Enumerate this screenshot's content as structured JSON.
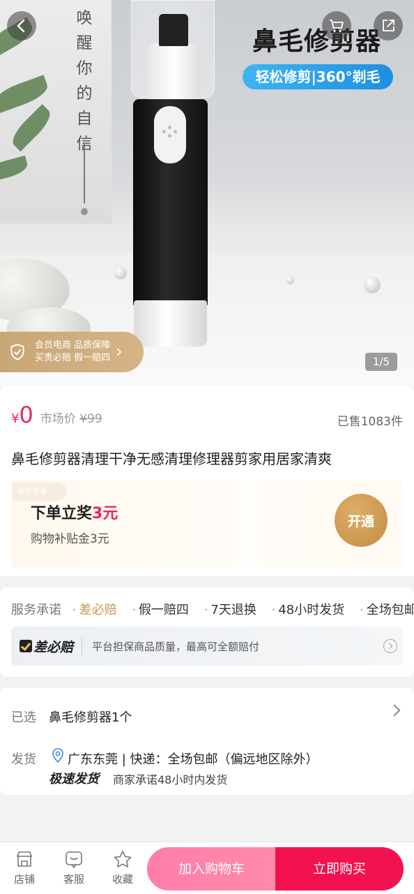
{
  "hero": {
    "vertical_text": "唤醒你的自信",
    "title": "鼻毛修剪器",
    "subtitle": "轻松修剪|360°剃毛",
    "guarantee_line1": "会员电商 品质保障",
    "guarantee_line2": "买贵必赔 假一赔四",
    "page_indicator": "1/5"
  },
  "price": {
    "currency": "¥",
    "value": "0",
    "market_label": "市场价",
    "market_price": "¥99",
    "sold": "已售1083件"
  },
  "product_title": "鼻毛修剪器清理干净无感清理修理器剪家用居家清爽",
  "promo": {
    "tag": "会员专享",
    "main_prefix": "下单立奖",
    "main_amount": "3元",
    "sub": "购物补贴金3元",
    "open_label": "开通"
  },
  "service": {
    "label": "服务承诺",
    "items": [
      "差必赔",
      "假一赔四",
      "7天退换",
      "48小时发货",
      "全场包邮"
    ],
    "badge": "差必赔",
    "desc": "平台担保商品质量，最高可全额赔付"
  },
  "spec": {
    "selected_label": "已选",
    "selected_value": "鼻毛修剪器1个",
    "ship_label": "发货",
    "ship_value": "广东东莞 | 快递：全场包邮（偏远地区除外）",
    "fast_label": "极速发货",
    "fast_note": "商家承诺48小时内发货"
  },
  "bottom": {
    "shop": "店铺",
    "service": "客服",
    "favorite": "收藏",
    "add_cart": "加入购物车",
    "buy_now": "立即购买"
  },
  "colors": {
    "accent": "#f0245a",
    "gold": "#c49a5b",
    "cart_button": "#ff85aa",
    "buy_button": "#f2124f"
  }
}
